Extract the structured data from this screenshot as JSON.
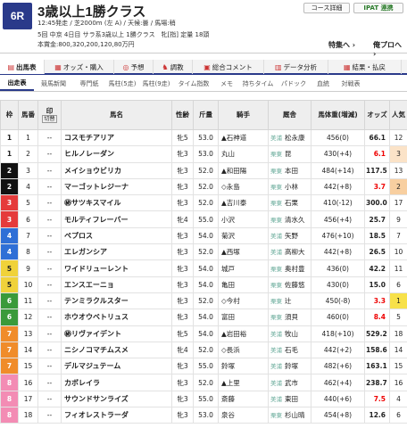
{
  "race": {
    "number": "6R",
    "name": "3歳以上1勝クラス",
    "info1": "12:45発走 / 芝2000m (左 A) / 天候:曇 / 馬場:稍",
    "info2": "5回 中京 4日目 サラ系3歳以上 1勝クラス　牝[指] 定量 18頭",
    "info3": "本賞金:800,320,200,120,80万円"
  },
  "header_buttons": {
    "course": "コース詳細",
    "ipat": "IPAT 連携"
  },
  "header_links": {
    "special": "特集へ ›",
    "pro": "俺プロへ ›"
  },
  "tabs": [
    {
      "label": "出馬表",
      "icon": "list-icon"
    },
    {
      "label": "オッズ・購入",
      "icon": "ticket-icon"
    },
    {
      "label": "予想",
      "icon": "target-icon"
    },
    {
      "label": "調教",
      "icon": "horse-icon"
    },
    {
      "label": "総合コメント",
      "icon": "comment-icon"
    },
    {
      "label": "データ分析",
      "icon": "chart-icon"
    },
    {
      "label": "結果・払戻",
      "icon": "trophy-icon"
    }
  ],
  "subtabs": [
    "出走表",
    "競馬新聞",
    "専門紙",
    "馬柱(5走)",
    "馬柱(9走)",
    "タイム指数",
    "メモ",
    "持ちタイム",
    "パドック",
    "血統",
    "対戦表"
  ],
  "columns": [
    "枠",
    "馬番",
    "印",
    "馬名",
    "性齢",
    "斤量",
    "騎手",
    "厩舎",
    "馬体重(増減)",
    "オッズ",
    "人気"
  ],
  "mark_label": "印",
  "mark_sub": "切替",
  "rows": [
    {
      "waku": "1",
      "num": "1",
      "mark": "--",
      "name": "コスモチアリア",
      "sex_age": "牝5",
      "weight": "53.0",
      "jockey": "▲石神道",
      "aff": "美浦",
      "trainer": "松永康",
      "body": "456(0)",
      "odds": "66.1",
      "pop": "12"
    },
    {
      "waku": "1",
      "num": "2",
      "mark": "--",
      "name": "ヒルノレーダン",
      "sex_age": "牝3",
      "weight": "53.0",
      "jockey": "丸山",
      "aff": "栗東",
      "trainer": "昆",
      "body": "430(+4)",
      "odds": "6.1",
      "pop": "3"
    },
    {
      "waku": "2",
      "num": "3",
      "mark": "--",
      "name": "メイショウビリカ",
      "sex_age": "牝3",
      "weight": "52.0",
      "jockey": "▲和田陽",
      "aff": "栗東",
      "trainer": "本田",
      "body": "484(+14)",
      "odds": "117.5",
      "pop": "13"
    },
    {
      "waku": "2",
      "num": "4",
      "mark": "--",
      "name": "マーゴットレジーナ",
      "sex_age": "牝3",
      "weight": "52.0",
      "jockey": "◇永島",
      "aff": "栗東",
      "trainer": "小林",
      "body": "442(+8)",
      "odds": "3.7",
      "pop": "2"
    },
    {
      "waku": "3",
      "num": "5",
      "mark": "--",
      "name": "㊙サツキスマイル",
      "sex_age": "牝3",
      "weight": "52.0",
      "jockey": "▲吉川泰",
      "aff": "栗東",
      "trainer": "石栗",
      "body": "410(-12)",
      "odds": "300.0",
      "pop": "17"
    },
    {
      "waku": "3",
      "num": "6",
      "mark": "--",
      "name": "モルティフレーバー",
      "sex_age": "牝4",
      "weight": "55.0",
      "jockey": "小沢",
      "aff": "栗東",
      "trainer": "清水久",
      "body": "456(+4)",
      "odds": "25.7",
      "pop": "9"
    },
    {
      "waku": "4",
      "num": "7",
      "mark": "--",
      "name": "ペプロス",
      "sex_age": "牝3",
      "weight": "54.0",
      "jockey": "菊沢",
      "aff": "美浦",
      "trainer": "矢野",
      "body": "476(+10)",
      "odds": "18.5",
      "pop": "7"
    },
    {
      "waku": "4",
      "num": "8",
      "mark": "--",
      "name": "エレガンシア",
      "sex_age": "牝3",
      "weight": "52.0",
      "jockey": "▲西塚",
      "aff": "美浦",
      "trainer": "高柳大",
      "body": "442(+8)",
      "odds": "26.5",
      "pop": "10"
    },
    {
      "waku": "5",
      "num": "9",
      "mark": "--",
      "name": "ワイドリューレント",
      "sex_age": "牝3",
      "weight": "54.0",
      "jockey": "城戸",
      "aff": "栗東",
      "trainer": "奥村豊",
      "body": "436(0)",
      "odds": "42.2",
      "pop": "11"
    },
    {
      "waku": "5",
      "num": "10",
      "mark": "--",
      "name": "エンスエーニョ",
      "sex_age": "牝3",
      "weight": "54.0",
      "jockey": "亀田",
      "aff": "栗東",
      "trainer": "佐藤悠",
      "body": "430(0)",
      "odds": "15.0",
      "pop": "6"
    },
    {
      "waku": "6",
      "num": "11",
      "mark": "--",
      "name": "テンミラクルスター",
      "sex_age": "牝3",
      "weight": "52.0",
      "jockey": "◇今村",
      "aff": "栗東",
      "trainer": "辻",
      "body": "450(-8)",
      "odds": "3.3",
      "pop": "1"
    },
    {
      "waku": "6",
      "num": "12",
      "mark": "--",
      "name": "ホウオウベトリュス",
      "sex_age": "牝3",
      "weight": "54.0",
      "jockey": "富田",
      "aff": "栗東",
      "trainer": "須貝",
      "body": "460(0)",
      "odds": "8.4",
      "pop": "5"
    },
    {
      "waku": "7",
      "num": "13",
      "mark": "--",
      "name": "㊙リヴァイデント",
      "sex_age": "牝5",
      "weight": "54.0",
      "jockey": "▲岩田裕",
      "aff": "美浦",
      "trainer": "牧山",
      "body": "418(+10)",
      "odds": "529.2",
      "pop": "18"
    },
    {
      "waku": "7",
      "num": "14",
      "mark": "--",
      "name": "ニシノコマチムスメ",
      "sex_age": "牝4",
      "weight": "52.0",
      "jockey": "◇長浜",
      "aff": "美浦",
      "trainer": "石毛",
      "body": "442(+2)",
      "odds": "158.6",
      "pop": "14"
    },
    {
      "waku": "7",
      "num": "15",
      "mark": "--",
      "name": "デルマジュテーム",
      "sex_age": "牝3",
      "weight": "55.0",
      "jockey": "鈴塚",
      "aff": "美浦",
      "trainer": "鈴塚",
      "body": "482(+6)",
      "odds": "163.1",
      "pop": "15"
    },
    {
      "waku": "8",
      "num": "16",
      "mark": "--",
      "name": "カボレイラ",
      "sex_age": "牝3",
      "weight": "52.0",
      "jockey": "▲上里",
      "aff": "美浦",
      "trainer": "武市",
      "body": "462(+4)",
      "odds": "238.7",
      "pop": "16"
    },
    {
      "waku": "8",
      "num": "17",
      "mark": "--",
      "name": "サウンドサンライズ",
      "sex_age": "牝3",
      "weight": "55.0",
      "jockey": "斎藤",
      "aff": "美浦",
      "trainer": "東田",
      "body": "440(+6)",
      "odds": "7.5",
      "pop": "4"
    },
    {
      "waku": "8",
      "num": "18",
      "mark": "--",
      "name": "フィオレストラーダ",
      "sex_age": "牝3",
      "weight": "53.0",
      "jockey": "泉谷",
      "aff": "栗東",
      "trainer": "杉山晴",
      "body": "454(+8)",
      "odds": "12.6",
      "pop": "6"
    }
  ],
  "colors": {
    "waku1": "#ffffff",
    "waku2": "#111111",
    "waku3": "#e53b3b",
    "waku4": "#2f6fd6",
    "waku5": "#f0d23a",
    "waku6": "#3a9a3a",
    "waku7": "#f08c2a",
    "waku8": "#f38cb4",
    "accent": "#2a3a8a"
  }
}
